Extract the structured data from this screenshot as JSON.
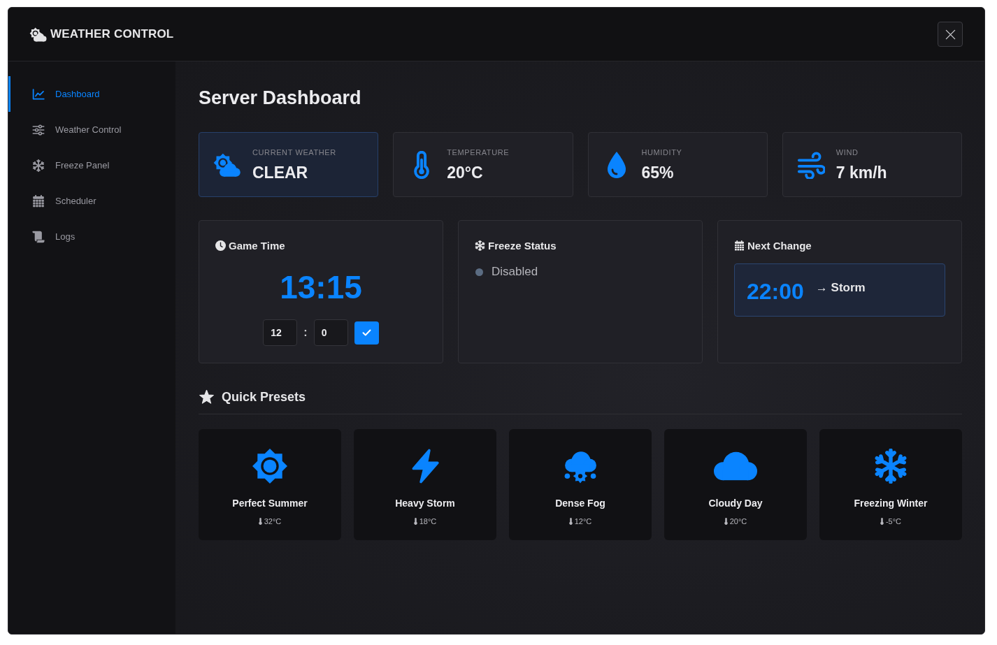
{
  "window": {
    "title": "WEATHER CONTROL"
  },
  "sidebar": {
    "items": [
      {
        "label": "Dashboard",
        "selected": true
      },
      {
        "label": "Weather Control",
        "selected": false
      },
      {
        "label": "Freeze Panel",
        "selected": false
      },
      {
        "label": "Scheduler",
        "selected": false
      },
      {
        "label": "Logs",
        "selected": false
      }
    ]
  },
  "main": {
    "title": "Server Dashboard",
    "stats": [
      {
        "label": "CURRENT WEATHER",
        "value": "CLEAR",
        "highlighted": true
      },
      {
        "label": "TEMPERATURE",
        "value": "20°C",
        "highlighted": false
      },
      {
        "label": "HUMIDITY",
        "value": "65%",
        "highlighted": false
      },
      {
        "label": "WIND",
        "value": "7 km/h",
        "highlighted": false
      }
    ],
    "game_time": {
      "title": "Game Time",
      "time": "13:15",
      "hour": "12",
      "separator": ":",
      "minute": "0"
    },
    "freeze_status": {
      "title": "Freeze Status",
      "enabled": false,
      "status": "Disabled"
    },
    "next_change": {
      "title": "Next Change",
      "time": "22:00",
      "weather": "→ Storm"
    },
    "quick_presets": {
      "title": "Quick Presets",
      "presets": [
        {
          "name": "Perfect Summer",
          "temperature": "32°C"
        },
        {
          "name": "Heavy Storm",
          "temperature": "18°C"
        },
        {
          "name": "Dense Fog",
          "temperature": "12°C"
        },
        {
          "name": "Cloudy Day",
          "temperature": "20°C"
        },
        {
          "name": "Freezing Winter",
          "temperature": "-5°C"
        }
      ]
    }
  }
}
